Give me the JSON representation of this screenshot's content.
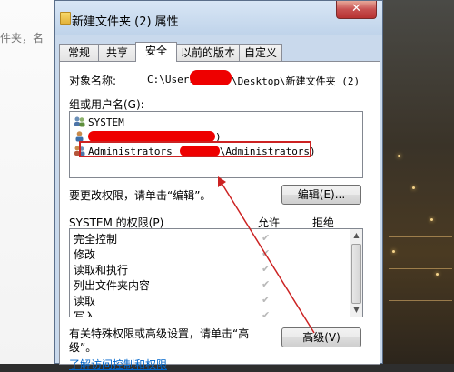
{
  "background": {
    "left_text": "件夹，名"
  },
  "window": {
    "title": "新建文件夹 (2) 属性",
    "close_label": "✕"
  },
  "tabs": [
    {
      "label": "常规"
    },
    {
      "label": "共享"
    },
    {
      "label": "安全",
      "active": true
    },
    {
      "label": "以前的版本"
    },
    {
      "label": "自定义"
    }
  ],
  "security": {
    "object_name_label": "对象名称:",
    "object_path_prefix": "C:\\Users",
    "object_path_suffix": "\\Desktop\\新建文件夹 (2)",
    "groups_label": "组或用户名(G):",
    "groups": [
      {
        "name": "SYSTEM",
        "icon": "user-group-icon"
      },
      {
        "name": ")",
        "icon": "user-group-icon"
      },
      {
        "name": "Administrators",
        "suffix": "\\Administrators)",
        "icon": "user-group-icon"
      }
    ],
    "change_perm_text": "要更改权限，请单击“编辑”。",
    "edit_button": "编辑(E)...",
    "perm_header": "SYSTEM 的权限(P)",
    "allow_header": "允许",
    "deny_header": "拒绝",
    "permissions": [
      {
        "name": "完全控制",
        "allow": true
      },
      {
        "name": "修改",
        "allow": true
      },
      {
        "name": "读取和执行",
        "allow": true
      },
      {
        "name": "列出文件夹内容",
        "allow": true
      },
      {
        "name": "读取",
        "allow": true
      },
      {
        "name": "写入",
        "allow": true
      }
    ],
    "advanced_text_line1": "有关特殊权限或高级设置，请单击“高",
    "advanced_text_line2": "级”。",
    "advanced_button": "高级(V)",
    "help_link": "了解访问控制和权限"
  },
  "colors": {
    "annotation_red": "#cc2222",
    "redaction_red": "#ee0000",
    "title_gradient_top": "#d8e6f5"
  }
}
